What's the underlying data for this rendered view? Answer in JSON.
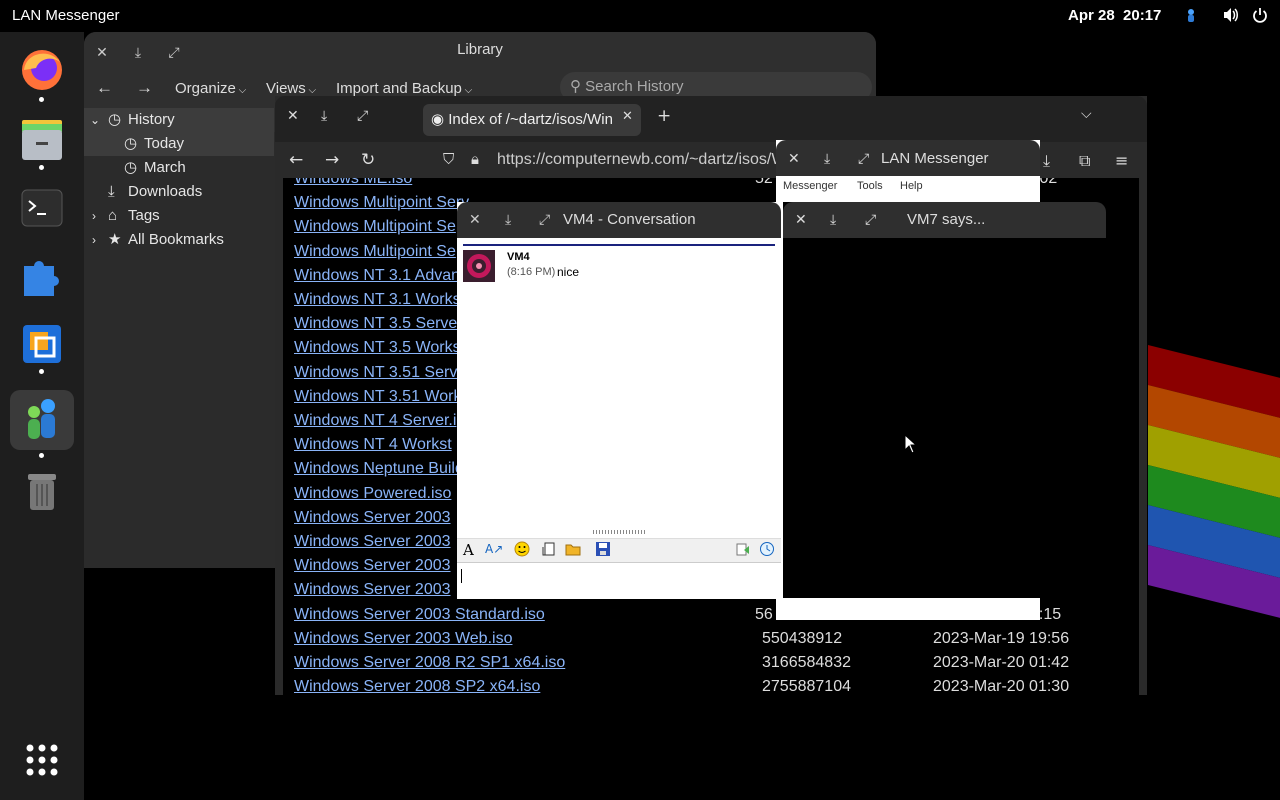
{
  "topbar": {
    "app_name": "LAN Messenger",
    "date": "Apr 28",
    "time": "20:17"
  },
  "dock": {
    "items": [
      "firefox-icon",
      "files-icon",
      "terminal-icon",
      "extensions-icon",
      "virtualbox-icon",
      "lan-messenger-icon",
      "trash-icon",
      "app-grid-icon"
    ]
  },
  "library": {
    "title": "Library",
    "toolbar": {
      "organize": "Organize",
      "views": "Views",
      "import_backup": "Import and Backup",
      "search_placeholder": "Search History"
    },
    "tree": {
      "history": "History",
      "today": "Today",
      "march": "March",
      "downloads": "Downloads",
      "tags": "Tags",
      "all_bookmarks": "All Bookmarks"
    }
  },
  "browser": {
    "tab_title": "Index of /~dartz/isos/Win",
    "url": "https://computernewb.com/~dartz/isos/W",
    "files": [
      {
        "name": "Windows ME.iso",
        "size": "52",
        "date": ".02"
      },
      {
        "name": "Windows Multipoint Serv",
        "size": "",
        "date": ""
      },
      {
        "name": "Windows Multipoint Se",
        "size": "",
        "date": ""
      },
      {
        "name": "Windows Multipoint Se",
        "size": "",
        "date": ""
      },
      {
        "name": "Windows NT 3.1 Advan",
        "size": "",
        "date": ""
      },
      {
        "name": "Windows NT 3.1 Works",
        "size": "",
        "date": ""
      },
      {
        "name": "Windows NT 3.5 Serve",
        "size": "",
        "date": ""
      },
      {
        "name": "Windows NT 3.5 Works",
        "size": "",
        "date": ""
      },
      {
        "name": "Windows NT 3.51 Serv",
        "size": "",
        "date": ""
      },
      {
        "name": "Windows NT 3.51 Work",
        "size": "",
        "date": ""
      },
      {
        "name": "Windows NT 4 Server.i",
        "size": "",
        "date": ""
      },
      {
        "name": "Windows NT 4 Workst",
        "size": "",
        "date": ""
      },
      {
        "name": "Windows Neptune Build",
        "size": "",
        "date": ""
      },
      {
        "name": "Windows Powered.iso",
        "size": "",
        "date": ""
      },
      {
        "name": "Windows Server 2003",
        "size": "",
        "date": ""
      },
      {
        "name": "Windows Server 2003",
        "size": "",
        "date": ""
      },
      {
        "name": "Windows Server 2003",
        "size": "",
        "date": ""
      },
      {
        "name": "Windows Server 2003",
        "size": "",
        "date": ""
      },
      {
        "name": "Windows Server 2003 Standard.iso",
        "size": "56",
        "date": "3:15"
      },
      {
        "name": "Windows Server 2003 Web.iso",
        "size": "550438912",
        "date": "2023-Mar-19 19:56"
      },
      {
        "name": "Windows Server 2008 R2 SP1 x64.iso",
        "size": "3166584832",
        "date": "2023-Mar-20 01:42"
      },
      {
        "name": "Windows Server 2008 SP2 x64.iso",
        "size": "2755887104",
        "date": "2023-Mar-20 01:30"
      }
    ]
  },
  "lan_messenger": {
    "title": "LAN Messenger",
    "menu": {
      "messenger": "Messenger",
      "tools": "Tools",
      "help": "Help"
    }
  },
  "conversation": {
    "title": "VM4 - Conversation",
    "message": {
      "sender": "VM4",
      "time": "(8:16 PM)",
      "text": "nice"
    }
  },
  "vm7_window": {
    "title": "VM7 says..."
  },
  "colors": {
    "link": "#8ab4f8",
    "window_header": "#2f2f2f",
    "dark_bg": "#000000",
    "sidebar": "#2b2b2b"
  }
}
